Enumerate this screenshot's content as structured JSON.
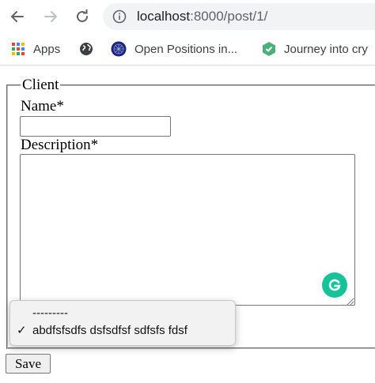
{
  "browser": {
    "url_host": "localhost",
    "url_rest": ":8000/post/1/",
    "bookmarks": [
      {
        "label": "Apps",
        "icon": "apps-grid-icon"
      },
      {
        "label": "",
        "icon": "globe-icon"
      },
      {
        "label": "Open Positions in...",
        "icon": "site-favicon-icon"
      },
      {
        "label": "Journey into cry",
        "icon": "hexagon-favicon-icon"
      }
    ]
  },
  "form": {
    "legend": "Client",
    "name_label": "Name*",
    "name_value": "",
    "description_label": "Description*",
    "description_value": "",
    "save_label": "Save"
  },
  "dropdown": {
    "options": [
      {
        "label": "---------",
        "selected": false
      },
      {
        "label": "abdfsfsdfs dsfsdfsf sdfsfs fdsf",
        "selected": true
      }
    ],
    "check_mark": "✓"
  },
  "colors": {
    "grammarly": "#15c39a",
    "omnibox_bg": "#f1f3f4"
  }
}
